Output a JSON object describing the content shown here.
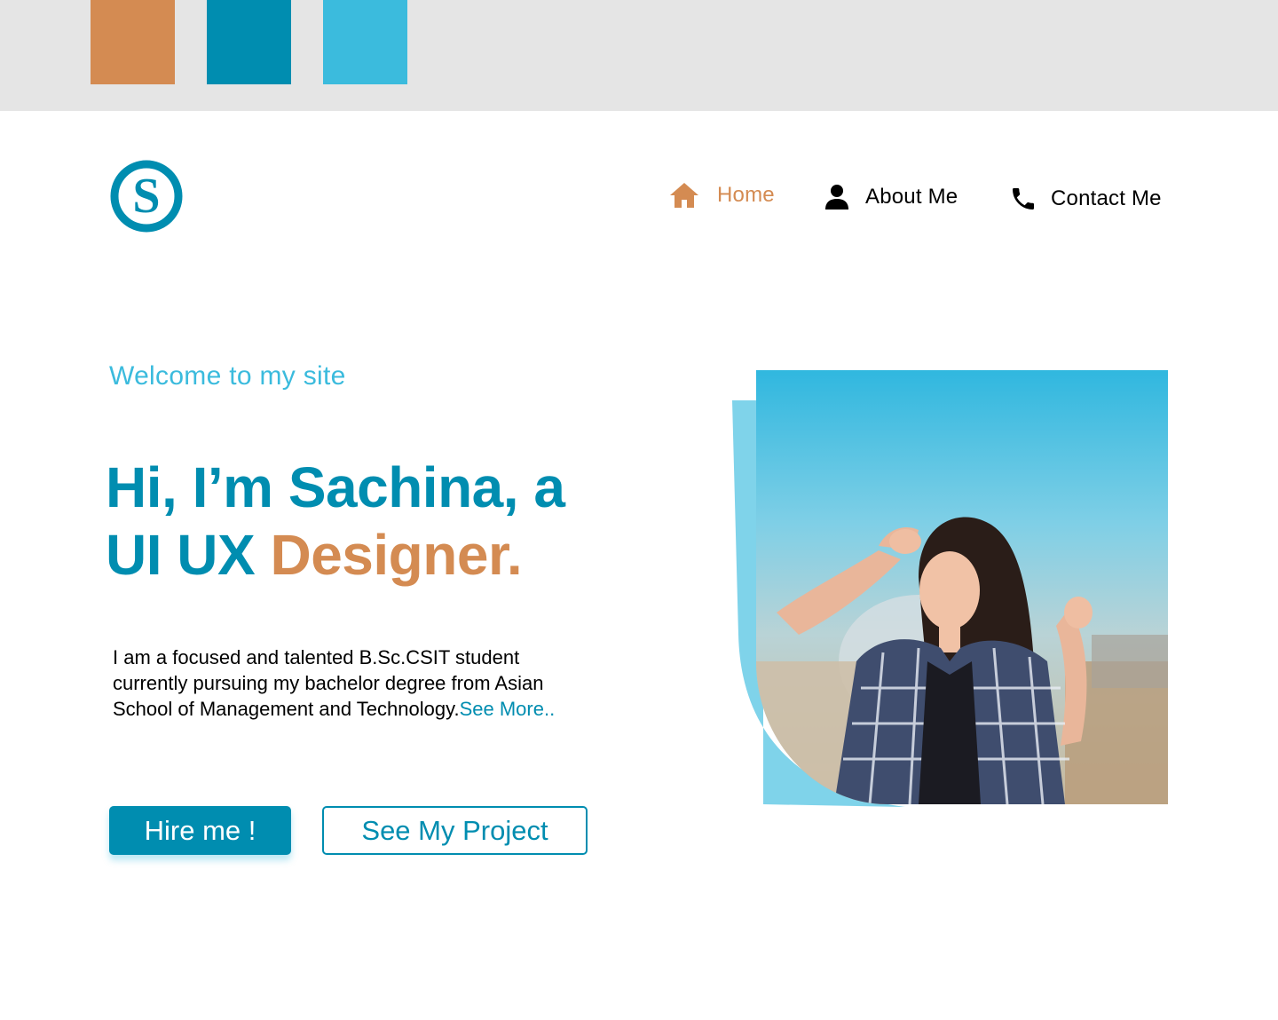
{
  "palette": {
    "colors": [
      "#d48b52",
      "#008db0",
      "#3bbbdd"
    ]
  },
  "brand": {
    "logo_letter": "S",
    "logo_color": "#008db0"
  },
  "nav": {
    "items": [
      {
        "label": "Home",
        "icon": "home-icon",
        "active": true
      },
      {
        "label": "About Me",
        "icon": "person-icon",
        "active": false
      },
      {
        "label": "Contact Me",
        "icon": "phone-icon",
        "active": false
      }
    ],
    "active_color": "#d48b52",
    "text_color": "#000000"
  },
  "hero": {
    "welcome": "Welcome to my site",
    "welcome_color": "#3bbbdd",
    "headline_line1": "Hi, I’m Sachina, a",
    "headline_line2_prefix": "UI UX ",
    "headline_line2_accent": "Designer.",
    "headline_color": "#008db0",
    "accent_color": "#d48b52",
    "intro_text_1": "I am a focused and talented B.Sc.CSIT student",
    "intro_text_2": "currently pursuing my bachelor degree from Asian",
    "intro_text_3": "School of Management and Technology.",
    "see_more": "See More..",
    "link_color": "#008db0"
  },
  "buttons": {
    "hire_label": "Hire me !",
    "project_label": "See My Project",
    "primary_color": "#008db0"
  },
  "photo": {
    "subject": "portrait-photo",
    "backdrop_color": "#7fd3ea"
  }
}
